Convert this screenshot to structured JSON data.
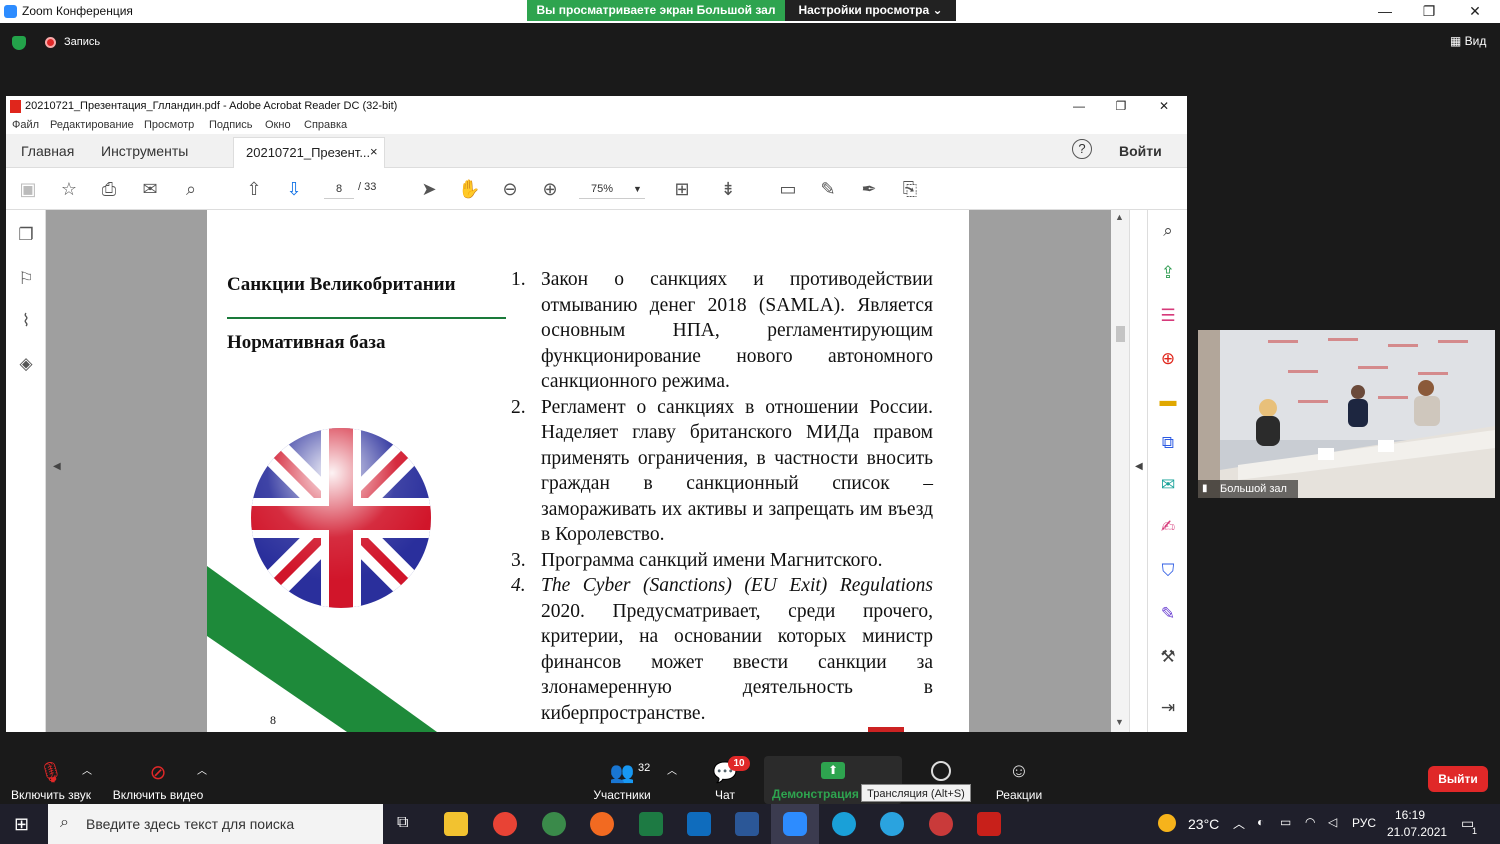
{
  "zoom": {
    "window_title": "Zoom Конференция",
    "share_banner": "Вы просматриваете экран Большой зал",
    "view_options": "Настройки просмотра ⌄",
    "recording": "Запись",
    "view": "Вид",
    "win_min": "—",
    "win_max": "❐",
    "win_close": "✕"
  },
  "acrobat": {
    "window_title": "20210721_Презентация_Глландин.pdf - Adobe Acrobat Reader DC (32-bit)",
    "menu": [
      "Файл",
      "Редактирование",
      "Просмотр",
      "Подпись",
      "Окно",
      "Справка"
    ],
    "tabs": {
      "home": "Главная",
      "tools": "Инструменты",
      "document": "20210721_Презент...",
      "close": "×"
    },
    "help": "?",
    "signin": "Войти",
    "page_current": "8",
    "page_total": "/ 33",
    "zoom": "75%"
  },
  "slide": {
    "title": "Санкции Великобритании",
    "subtitle": "Нормативная база",
    "page_number": "8",
    "items": [
      {
        "n": "1.",
        "text": "Закон о санкциях и противодействии отмыванию денег 2018 (SAMLA). Является основным НПА, регламентирующим функционирование нового автономного санкционного режима."
      },
      {
        "n": "2.",
        "text": "Регламент о санкциях в отношении России. Наделяет главу британского МИДа правом применять ограничения, в частности вносить граждан в санкционный список – замораживать их активы и запрещать им въезд в Королевство."
      },
      {
        "n": "3.",
        "text": "Программа санкций имени Магнитского."
      },
      {
        "n": "4.",
        "text_italic": "The Cyber (Sanctions) (EU Exit) Regulations",
        "text": "2020. Предусматривает, среди прочего, критерии, на основании которых министр финансов может ввести санкции за злонамеренную деятельность в киберпространстве."
      }
    ]
  },
  "camera": {
    "label": "Большой зал"
  },
  "bottom": {
    "mute": "Включить звук",
    "video": "Включить видео",
    "participants": "Участники",
    "participants_count": "32",
    "chat": "Чат",
    "chat_badge": "10",
    "share": "Демонстрация",
    "share_tooltip": "Трансляция (Alt+S)",
    "reactions": "Реакции",
    "leave": "Выйти"
  },
  "taskbar": {
    "search_placeholder": "Введите здесь текст для поиска",
    "weather": "23°C",
    "lang": "РУС",
    "time": "16:19",
    "date": "21.07.2021",
    "notifications": "1"
  },
  "colors": {
    "zoom_green": "#2ea44f",
    "leave_red": "#e02828",
    "slide_green": "#1e8a3a",
    "flag_blue": "#2a2f9c",
    "flag_red": "#d1152a"
  }
}
